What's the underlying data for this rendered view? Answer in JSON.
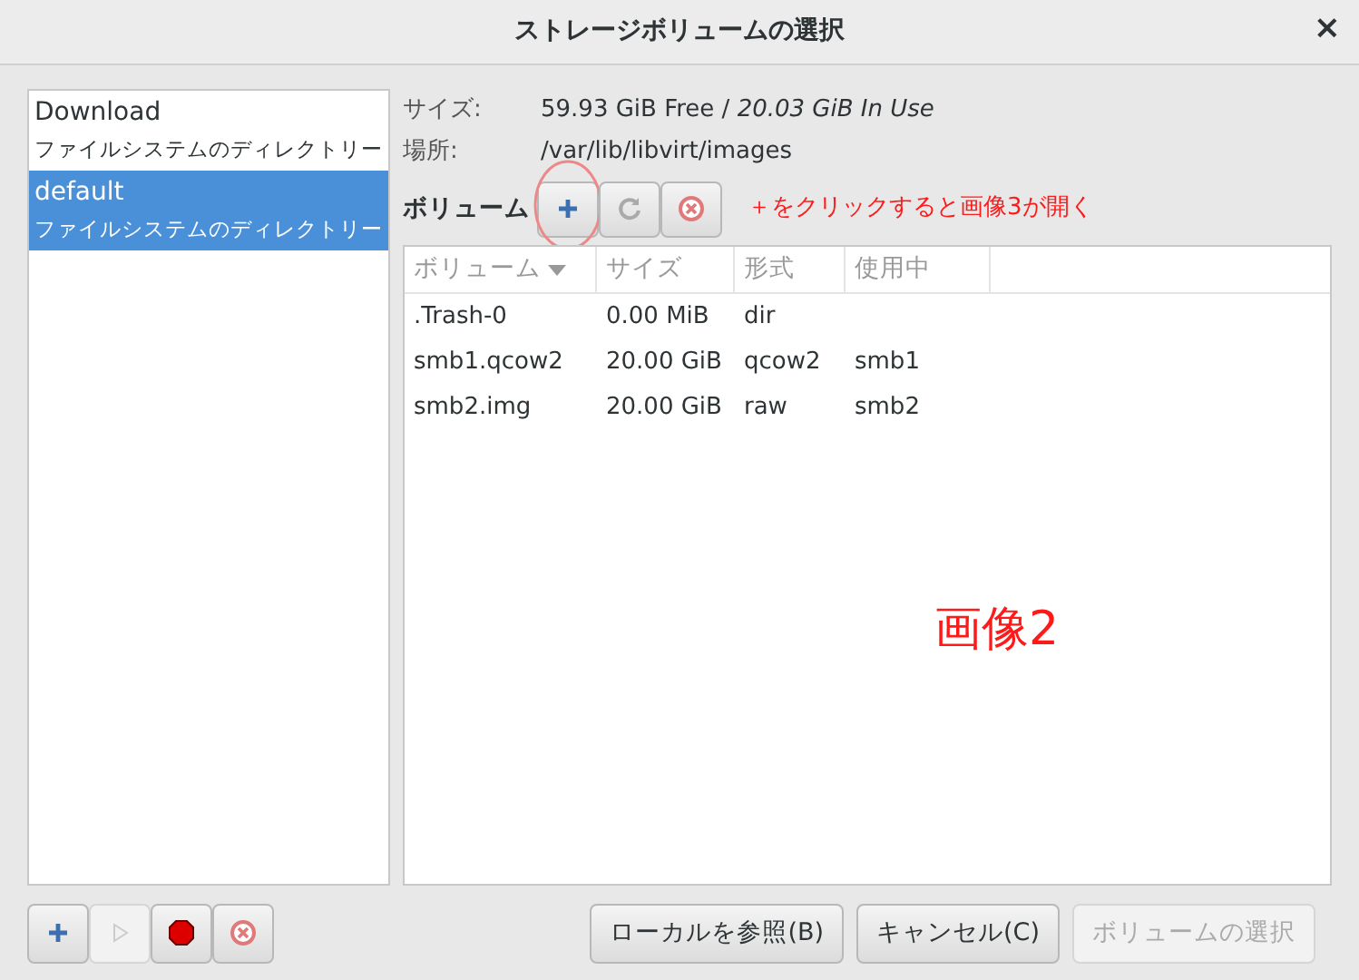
{
  "window": {
    "title": "ストレージボリュームの選択",
    "close": "×"
  },
  "pools": [
    {
      "name": "Download",
      "type": "ファイルシステムのディレクトリー",
      "selected": false
    },
    {
      "name": "default",
      "type": "ファイルシステムのディレクトリー",
      "selected": true
    }
  ],
  "info": [
    {
      "label": "サイズ:",
      "value": "59.93 GiB Free / ",
      "value_italic": "20.03 GiB In Use"
    },
    {
      "label": "場所:",
      "value": "/var/lib/libvirt/images"
    }
  ],
  "volume_toolbar": {
    "label": "ボリューム",
    "buttons": [
      {
        "kind": "add",
        "circled": true
      },
      {
        "kind": "refresh",
        "circled": false
      },
      {
        "kind": "delete",
        "circled": false
      }
    ],
    "annotation": "＋をクリックすると画像3が開く"
  },
  "table": {
    "columns": [
      {
        "label": "ボリューム",
        "sorted": true
      },
      {
        "label": "サイズ",
        "sorted": false
      },
      {
        "label": "形式",
        "sorted": false
      },
      {
        "label": "使用中",
        "sorted": false
      }
    ],
    "rows": [
      [
        ".Trash-0",
        "0.00 MiB",
        "dir",
        ""
      ],
      [
        "smb1.qcow2",
        "20.00 GiB",
        "qcow2",
        "smb1"
      ],
      [
        "smb2.img",
        "20.00 GiB",
        "raw",
        "smb2"
      ]
    ],
    "annotation": "画像2"
  },
  "pool_buttons": [
    {
      "kind": "add",
      "disabled": false
    },
    {
      "kind": "start",
      "disabled": true
    },
    {
      "kind": "stop",
      "disabled": false
    },
    {
      "kind": "delete",
      "disabled": false
    }
  ],
  "buttons": [
    {
      "label": "ローカルを参照(B)",
      "disabled": false
    },
    {
      "label": "キャンセル(C)",
      "disabled": false
    },
    {
      "label": "ボリュームの選択",
      "disabled": true
    }
  ]
}
